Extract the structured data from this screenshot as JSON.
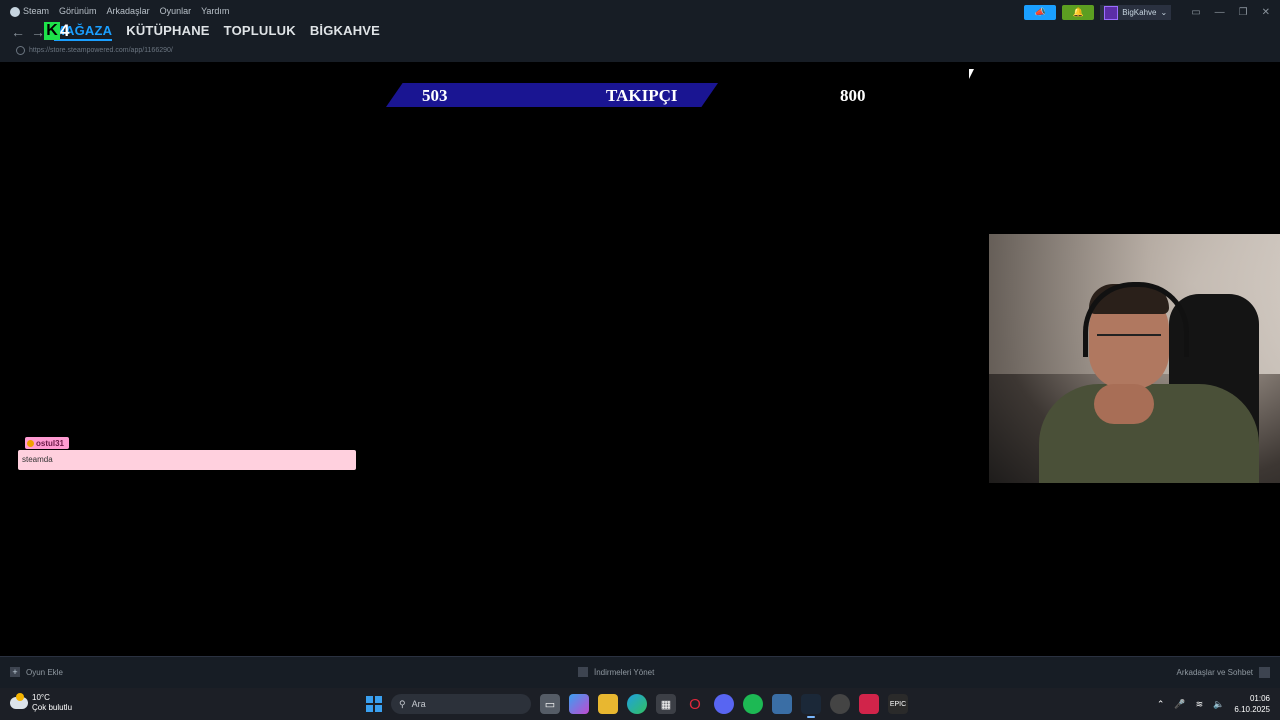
{
  "titlebar": {
    "menu": [
      "Steam",
      "Görünüm",
      "Arkadaşlar",
      "Oyunlar",
      "Yardım"
    ],
    "nav": [
      "MAĞAZA",
      "KÜTÜPHANE",
      "TOPLULUK",
      "BİGKAHVE"
    ],
    "url": "https://store.steampowered.com/app/1166290/",
    "profile_name": "BigKahve",
    "logo_text": {
      "k": "K",
      "n": "4"
    }
  },
  "overlay": {
    "left_value": "503",
    "label": "TAKIPÇI",
    "right_value": "800"
  },
  "chat": {
    "username": "ostul31",
    "message": "steamda"
  },
  "bottombar": {
    "add_game": "Oyun Ekle",
    "downloads": "İndirmeleri Yönet",
    "friends": "Arkadaşlar ve Sohbet"
  },
  "taskbar": {
    "temperature": "10°C",
    "weather": "Çok bulutlu",
    "search_placeholder": "Ara",
    "time": "01:06",
    "date": "6.10.2025"
  },
  "colors": {
    "accent": "#1a9fff",
    "overlay_bar": "#1a1592",
    "chat_bg": "#ffd0de"
  }
}
